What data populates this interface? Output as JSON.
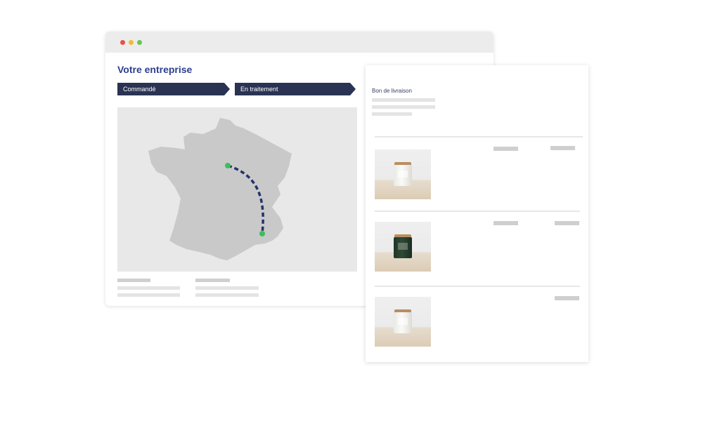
{
  "window": {
    "traffic_lights": [
      "#e5544b",
      "#f0bc37",
      "#64c756"
    ]
  },
  "company": {
    "title": "Votre entreprise"
  },
  "progress_steps": [
    {
      "label": "Commandé"
    },
    {
      "label": "En traitement"
    }
  ],
  "map": {
    "country": "France",
    "route_color": "#25336b",
    "marker_color": "#3bbf5a"
  },
  "delivery_note": {
    "title": "Bon de livraison",
    "items": [
      {
        "product": "candle-white-jar-icon"
      },
      {
        "product": "candle-green-jar-icon"
      },
      {
        "product": "candle-white-jar-icon"
      }
    ]
  },
  "colors": {
    "brand_blue": "#2c3e8f",
    "step_navy": "#2a3353",
    "placeholder_gray": "#e4e4e4"
  }
}
